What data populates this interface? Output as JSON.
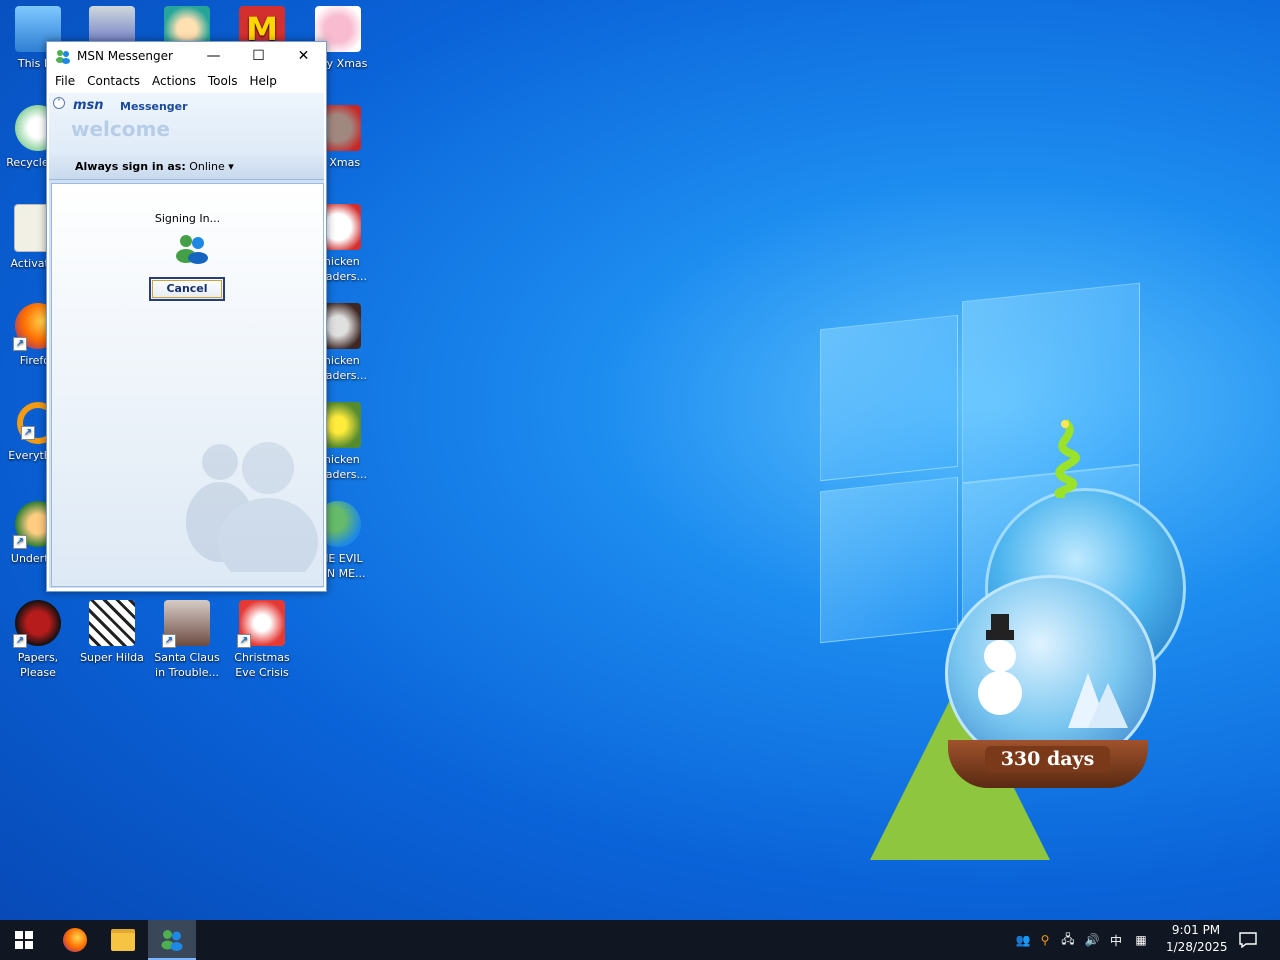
{
  "desktop": {
    "icons": [
      {
        "label": "This PC",
        "color": "#3a8ee0"
      },
      {
        "label": "Recycle Bin",
        "color": "#3aa55c"
      },
      {
        "label": "Activation",
        "color": "#e9e9e0"
      },
      {
        "label": "Firefox",
        "color": "#ff7b1a"
      },
      {
        "label": "Everything",
        "color": "#f39c12"
      },
      {
        "label": "Undertale",
        "color": "#2e7d32"
      },
      {
        "label": "Papers, Please",
        "color": "#1a1a1a"
      },
      {
        "label": "Super Hilda",
        "color": "#f3f3ee"
      },
      {
        "label": "Santa Claus in Trouble...",
        "color": "#8d6e63"
      },
      {
        "label": "Christmas Eve Crisis",
        "color": "#e57373"
      },
      {
        "label": "Ugly Xmas",
        "color": "#f4a7c0"
      },
      {
        "label": "Jo Xmas",
        "color": "#c0392b"
      },
      {
        "label": "Chicken Invaders...",
        "color": "#f5f5f5"
      },
      {
        "label": "Chicken Invaders...",
        "color": "#5d4037"
      },
      {
        "label": "Chicken Invaders...",
        "color": "#689f38"
      },
      {
        "label": "THE EVIL MEN ME...",
        "color": "#2e86c1"
      }
    ],
    "globe_counter": "330 days"
  },
  "window": {
    "title": "MSN Messenger",
    "controls": {
      "minimize": "—",
      "maximize": "☐",
      "close": "✕"
    },
    "menu": [
      "File",
      "Contacts",
      "Actions",
      "Tools",
      "Help"
    ],
    "brand_msn": "msn",
    "brand_messenger": "Messenger",
    "welcome": "welcome",
    "sign_in_label": "Always sign in as:",
    "sign_in_status": "Online",
    "signing_text": "Signing In...",
    "cancel_label": "Cancel"
  },
  "taskbar": {
    "time": "9:01 PM",
    "date": "1/28/2025",
    "ime": "中"
  }
}
